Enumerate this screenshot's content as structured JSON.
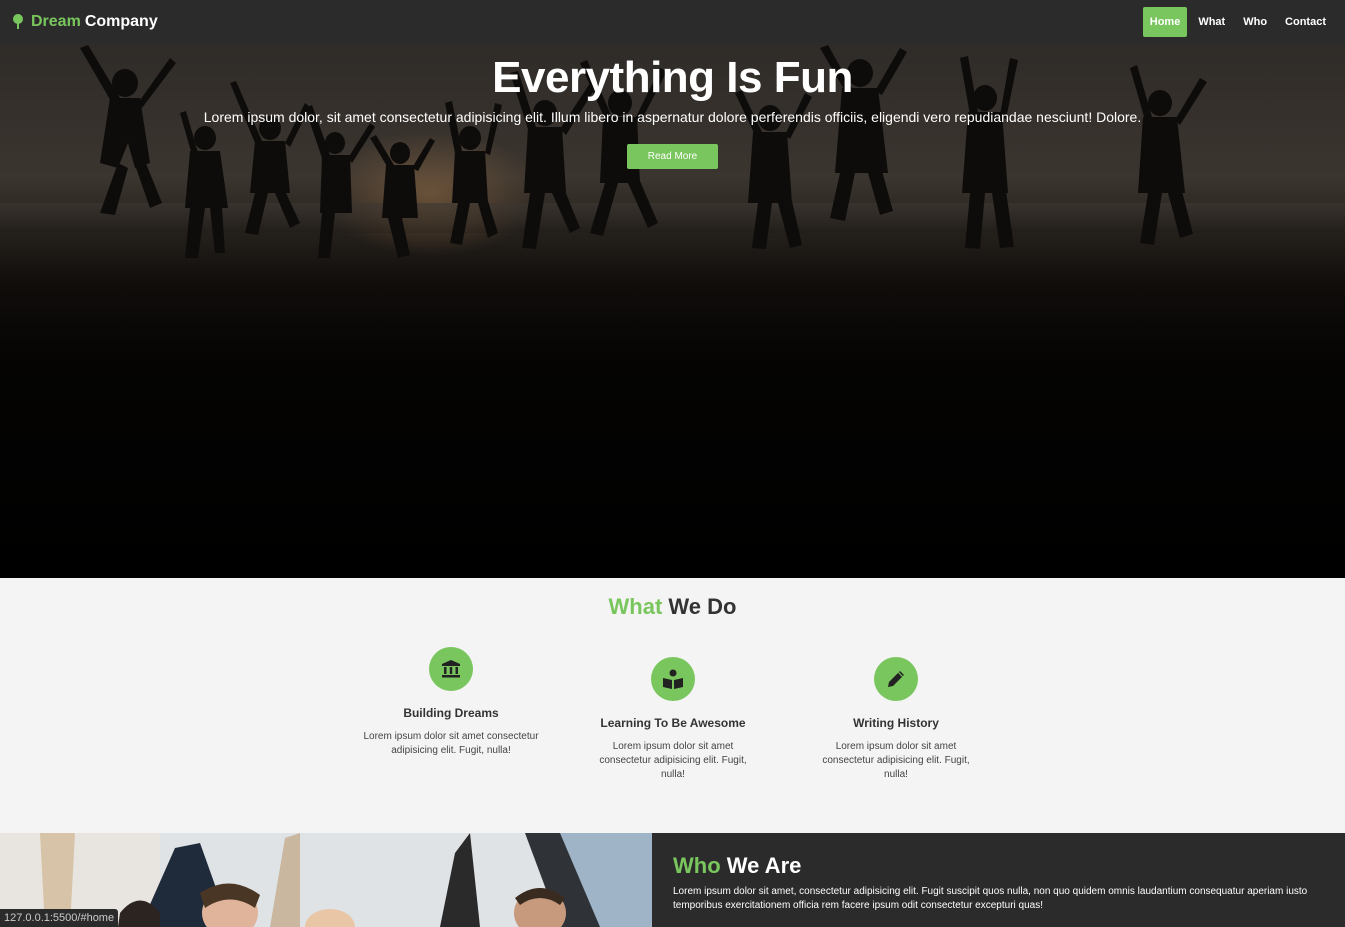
{
  "nav": {
    "brand_part1": "Dream",
    "brand_part2": "Company",
    "items": [
      {
        "label": "Home",
        "active": true
      },
      {
        "label": "What"
      },
      {
        "label": "Who"
      },
      {
        "label": "Contact"
      }
    ]
  },
  "hero": {
    "title": "Everything Is Fun",
    "text": "Lorem ipsum dolor, sit amet consectetur adipisicing elit. Illum libero in aspernatur dolore perferendis officiis, eligendi vero repudiandae nesciunt! Dolore.",
    "button": "Read More"
  },
  "what": {
    "title_highlight": "What",
    "title_rest": "We Do",
    "features": [
      {
        "icon": "bank-icon",
        "title": "Building Dreams",
        "text": "Lorem ipsum dolor sit amet consectetur adipisicing elit. Fugit, nulla!"
      },
      {
        "icon": "book-reader-icon",
        "title": "Learning To Be Awesome",
        "text": "Lorem ipsum dolor sit amet consectetur adipisicing elit. Fugit, nulla!"
      },
      {
        "icon": "pencil-icon",
        "title": "Writing History",
        "text": "Lorem ipsum dolor sit amet consectetur adipisicing elit. Fugit, nulla!"
      }
    ]
  },
  "who": {
    "title_highlight": "Who",
    "title_rest": "We Are",
    "text": "Lorem ipsum dolor sit amet, consectetur adipisicing elit. Fugit suscipit quos nulla, non quo quidem omnis laudantium consequatur aperiam iusto temporibus exercitationem officia rem facere ipsum odit consectetur excepturi quas!"
  },
  "status_url": "127.0.0.1:5500/#home",
  "colors": {
    "accent": "#7ac65e",
    "dark": "#2b2b2b"
  }
}
